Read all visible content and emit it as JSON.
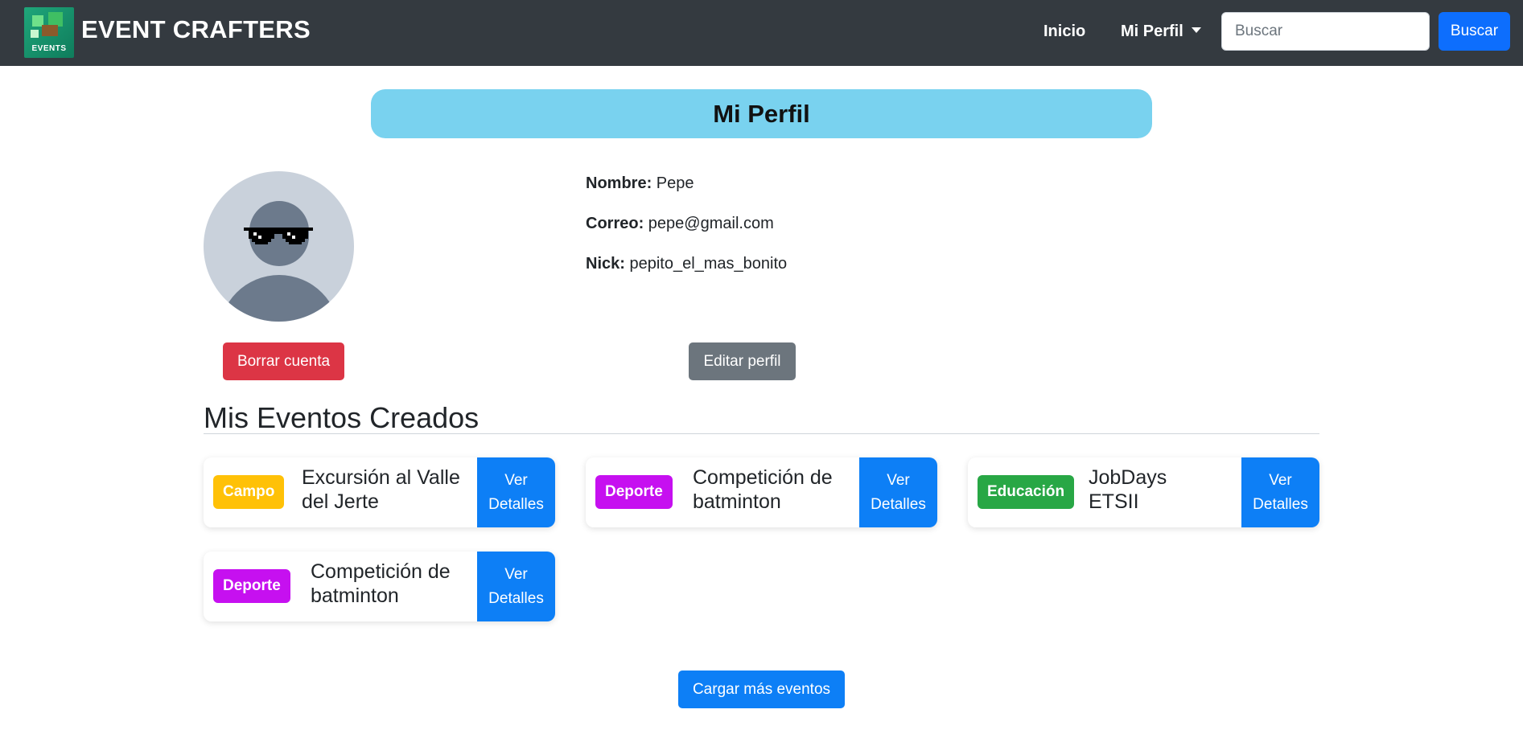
{
  "navbar": {
    "logo_text": "EVENTS",
    "brand": "EVENT CRAFTERS",
    "links": {
      "inicio": "Inicio",
      "perfil": "Mi Perfil"
    },
    "search": {
      "placeholder": "Buscar",
      "value": "",
      "button_label": "Buscar"
    }
  },
  "page": {
    "title": "Mi Perfil"
  },
  "profile": {
    "avatar_icon": "avatar-with-pixel-sunglasses",
    "name_label": "Nombre:",
    "name": "Pepe",
    "email_label": "Correo:",
    "email": "pepe@gmail.com",
    "nick_label": "Nick:",
    "nick": "pepito_el_mas_bonito",
    "delete_label": "Borrar cuenta",
    "edit_label": "Editar perfil"
  },
  "events_section": {
    "title": "Mis Eventos Creados",
    "load_more_label": "Cargar más eventos",
    "events": [
      {
        "category": "Campo",
        "category_color": "#ffc107",
        "title": "Excursión al Valle del Jerte",
        "button_label": "Ver Detalles"
      },
      {
        "category": "Deporte",
        "category_color": "#c610f0",
        "title": "Competición de batminton",
        "button_label": "Ver Detalles"
      },
      {
        "category": "Educación",
        "category_color": "#28a745",
        "title": "JobDays ETSII",
        "button_label": "Ver Detalles"
      },
      {
        "category": "Deporte",
        "category_color": "#c610f0",
        "title": "Competición de batminton",
        "button_label": "Ver Detalles"
      }
    ]
  },
  "colors": {
    "navbar_bg": "#343a40",
    "primary": "#0d6efd",
    "danger": "#dc3545",
    "secondary": "#6c757d",
    "title_bg": "#79d2ef"
  }
}
